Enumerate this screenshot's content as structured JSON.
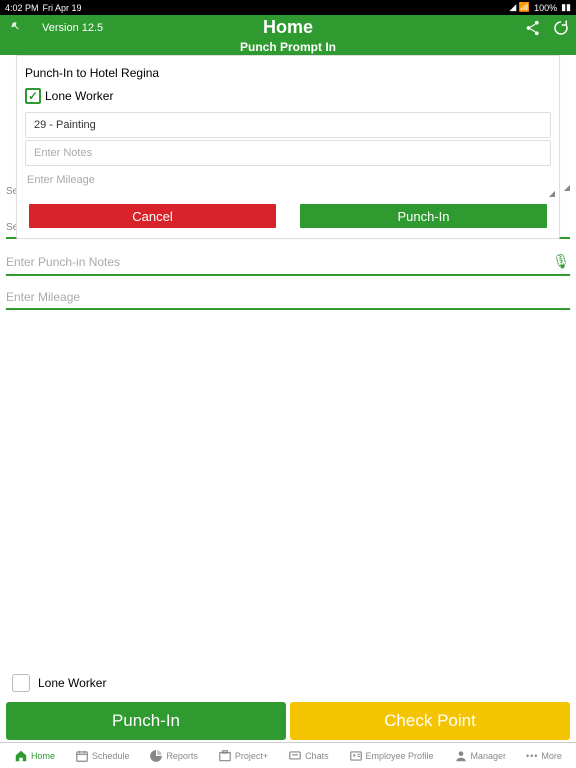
{
  "status": {
    "time": "4:02 PM",
    "date": "Fri Apr 19",
    "battery": "100%"
  },
  "header": {
    "version": "Version 12.5",
    "title": "Home",
    "subtitle": "Punch Prompt In"
  },
  "modal": {
    "title": "Punch-In to Hotel Regina",
    "lone_worker_label": "Lone Worker",
    "task_value": "29 - Painting",
    "notes_placeholder": "Enter Notes",
    "mileage_placeholder": "Enter Mileage",
    "cancel_label": "Cancel",
    "punch_label": "Punch-In"
  },
  "bg": {
    "sel_label": "Sel",
    "task_label": "Select Task or Service",
    "notes_placeholder": "Enter Punch-in Notes",
    "mileage_placeholder": "Enter Mileage"
  },
  "bottom": {
    "lone_worker_label": "Lone Worker",
    "punch_in_label": "Punch-In",
    "check_point_label": "Check Point"
  },
  "tabs": {
    "home": "Home",
    "schedule": "Schedule",
    "reports": "Reports",
    "project": "Project+",
    "chats": "Chats",
    "profile": "Employee Profile",
    "manager": "Manager",
    "more": "More"
  }
}
